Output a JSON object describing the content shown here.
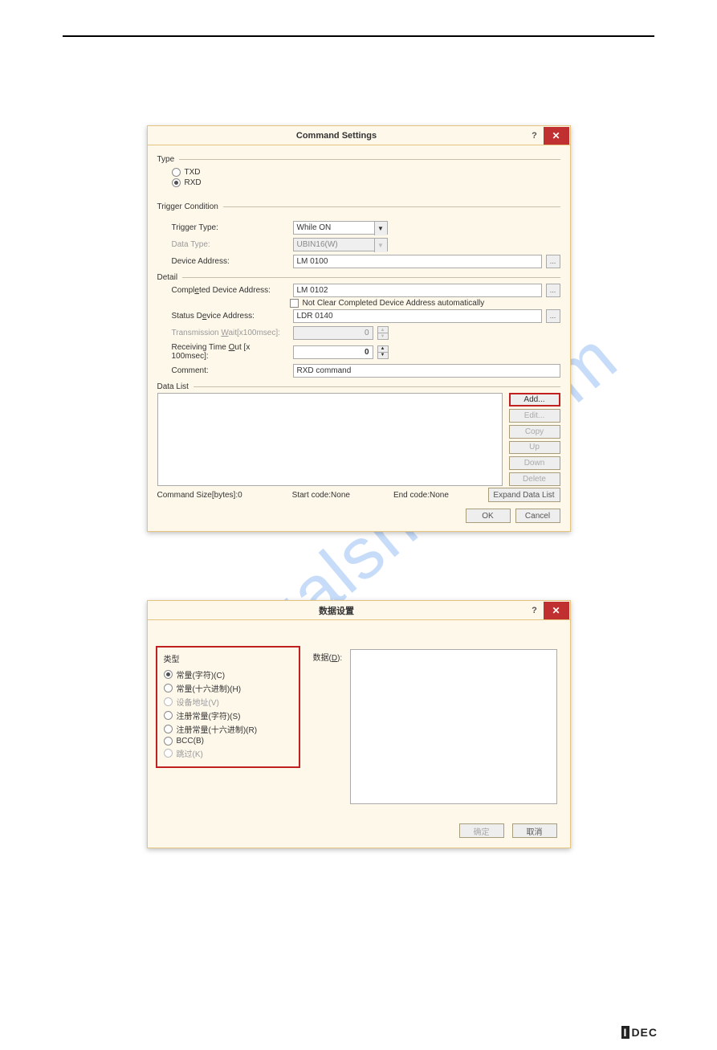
{
  "watermark": "manualshive.com",
  "dlg1": {
    "title": "Command Settings",
    "help": "?",
    "type": {
      "label": "Type",
      "txd": "TXD",
      "rxd": "RXD"
    },
    "trigger": {
      "label": "Trigger Condition",
      "ttype": "Trigger Type:",
      "ttype_val": "While ON",
      "dtype": "Data Type:",
      "dtype_val": "UBIN16(W)",
      "devaddr": "Device Address:",
      "devaddr_val": "LM 0100"
    },
    "detail": {
      "label": "Detail",
      "compl_lbl_a": "Compl",
      "compl_lbl_u": "e",
      "compl_lbl_b": "ted Device Address:",
      "compl_val": "LM 0102",
      "chk_u": "N",
      "chk_rest": "ot Clear Completed Device Address automatically",
      "status_lbl_a": "Status D",
      "status_lbl_u": "e",
      "status_lbl_b": "vice Address:",
      "status_val": "LDR 0140",
      "twait_a": "Transmission ",
      "twait_u": "W",
      "twait_b": "ait[x100msec]:",
      "twait_val": "0",
      "rtime_a": "Receiving Time ",
      "rtime_u": "O",
      "rtime_b": "ut [x 100msec]:",
      "rtime_val": "0",
      "comment_lbl": "Comment:",
      "comment_val": "RXD command"
    },
    "datalist": {
      "label": "Data List",
      "btns": [
        "Add...",
        "Edit...",
        "Copy",
        "Up",
        "Down",
        "Delete"
      ]
    },
    "foot": {
      "cmdsize": "Command Size[bytes]:0",
      "start": "Start code:None",
      "end": "End code:None",
      "expand": "Expand Data List",
      "ok": "OK",
      "cancel": "Cancel"
    }
  },
  "dlg2": {
    "title": "数据设置",
    "help": "?",
    "type_label": "类型",
    "opts": [
      "常量(字符)(C)",
      "常量(十六进制)(H)",
      "设备地址(V)",
      "注册常量(字符)(S)",
      "注册常量(十六进制)(R)",
      "BCC(B)",
      "跳过(K)"
    ],
    "data_lbl_a": "数据(",
    "data_lbl_u": "D",
    "data_lbl_b": "):",
    "ok": "确定",
    "cancel": "取消"
  }
}
